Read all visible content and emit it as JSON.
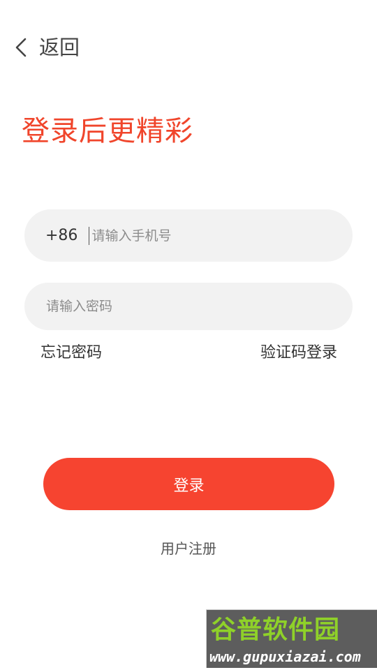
{
  "header": {
    "back_label": "返回",
    "back_icon": "chevron-left-icon"
  },
  "page": {
    "title": "登录后更精彩"
  },
  "form": {
    "country_code": "+86",
    "phone_placeholder": "请输入手机号",
    "phone_value": "",
    "password_placeholder": "请输入密码",
    "password_value": ""
  },
  "links": {
    "forgot_password": "忘记密码",
    "code_login": "验证码登录"
  },
  "actions": {
    "login_label": "登录",
    "register_label": "用户注册"
  },
  "watermark": {
    "title": "谷普软件园",
    "url": "www.gupuxiazai.com"
  },
  "colors": {
    "accent": "#f64430",
    "title": "#f0452b",
    "input_background": "#f2f2f2",
    "watermark_green": "#8fd129"
  }
}
